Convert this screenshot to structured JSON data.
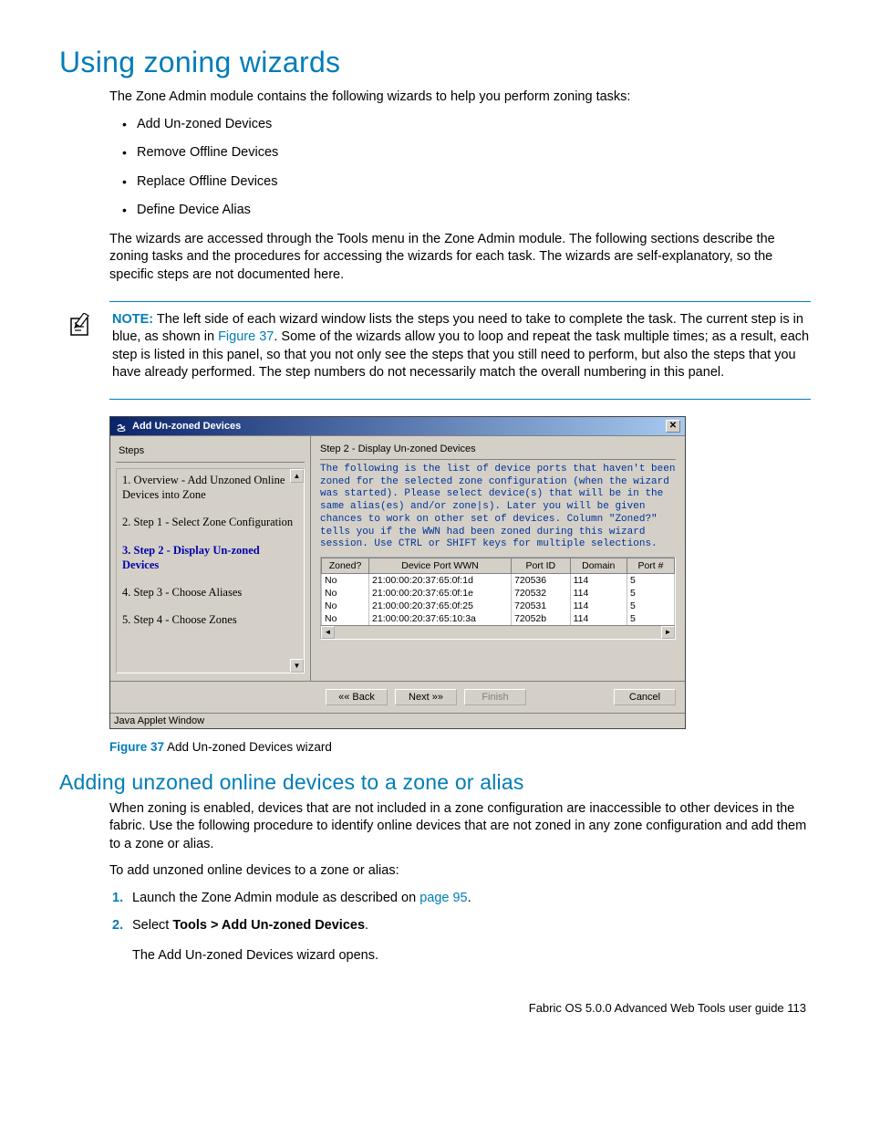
{
  "h1": "Using zoning wizards",
  "intro": "The Zone Admin module contains the following wizards to help you perform zoning tasks:",
  "wizards": [
    "Add Un-zoned Devices",
    "Remove Offline Devices",
    "Replace Offline Devices",
    "Define Device Alias"
  ],
  "intro2": "The wizards are accessed through the Tools menu in the Zone Admin module. The following sections describe the zoning tasks and the procedures for accessing the wizards for each task. The wizards are self-explanatory, so the specific steps are not documented here.",
  "note": {
    "label": "NOTE:",
    "before_link": "The left side of each wizard window lists the steps you need to take to complete the task. The current step is in blue, as shown in ",
    "link": "Figure 37",
    "after_link": ". Some of the wizards allow you to loop and repeat the task multiple times; as a result, each step is listed in this panel, so that you not only see the steps that you still need to perform, but also the steps that you have already performed. The step numbers do not necessarily match the overall numbering in this panel."
  },
  "wizard": {
    "title": "Add Un-zoned Devices",
    "left_title": "Steps",
    "steps": [
      {
        "text": "1. Overview - Add Unzoned Online Devices into Zone",
        "current": false
      },
      {
        "text": "2. Step 1 - Select Zone Configuration",
        "current": false
      },
      {
        "text": "3. Step 2 - Display Un-zoned Devices",
        "current": true
      },
      {
        "text": "4. Step 3 - Choose Aliases",
        "current": false
      },
      {
        "text": "5. Step 4 - Choose Zones",
        "current": false
      }
    ],
    "right_title": "Step 2 - Display Un-zoned Devices",
    "desc": "The following is the list of device ports that haven't been zoned for the selected zone configuration (when the wizard was started). Please select device(s) that will be in the same alias(es) and/or zone|s). Later you will be given chances to work on other set of devices. Column \"Zoned?\" tells you if the WWN had been zoned during this wizard session. Use CTRL or SHIFT keys for multiple selections.",
    "columns": [
      "Zoned?",
      "Device Port WWN",
      "Port ID",
      "Domain",
      "Port #"
    ],
    "rows": [
      [
        "No",
        "21:00:00:20:37:65:0f:1d",
        "720536",
        "114",
        "5"
      ],
      [
        "No",
        "21:00:00:20:37:65:0f:1e",
        "720532",
        "114",
        "5"
      ],
      [
        "No",
        "21:00:00:20:37:65:0f:25",
        "720531",
        "114",
        "5"
      ],
      [
        "No",
        "21:00:00:20:37:65:10:3a",
        "72052b",
        "114",
        "5"
      ]
    ],
    "buttons": {
      "back": "«« Back",
      "next": "Next »»",
      "finish": "Finish",
      "cancel": "Cancel"
    },
    "status": "Java Applet Window"
  },
  "figure_caption": {
    "bold": "Figure 37",
    "rest": " Add Un-zoned Devices wizard"
  },
  "h2": "Adding unzoned online devices to a zone or alias",
  "p2": "When zoning is enabled, devices that are not included in a zone configuration are inaccessible to other devices in the fabric. Use the following procedure to identify online devices that are not zoned in any zone configuration and add them to a zone or alias.",
  "p3": "To add unzoned online devices to a zone or alias:",
  "ol": [
    {
      "num": "1.",
      "before": "Launch the Zone Admin module as described on ",
      "link": "page 95",
      "after": "."
    },
    {
      "num": "2.",
      "before": "Select ",
      "bold": "Tools > Add Un-zoned Devices",
      "after": "."
    }
  ],
  "p4": "The Add Un-zoned Devices wizard opens.",
  "footer": "Fabric OS 5.0.0 Advanced Web Tools user guide   113"
}
